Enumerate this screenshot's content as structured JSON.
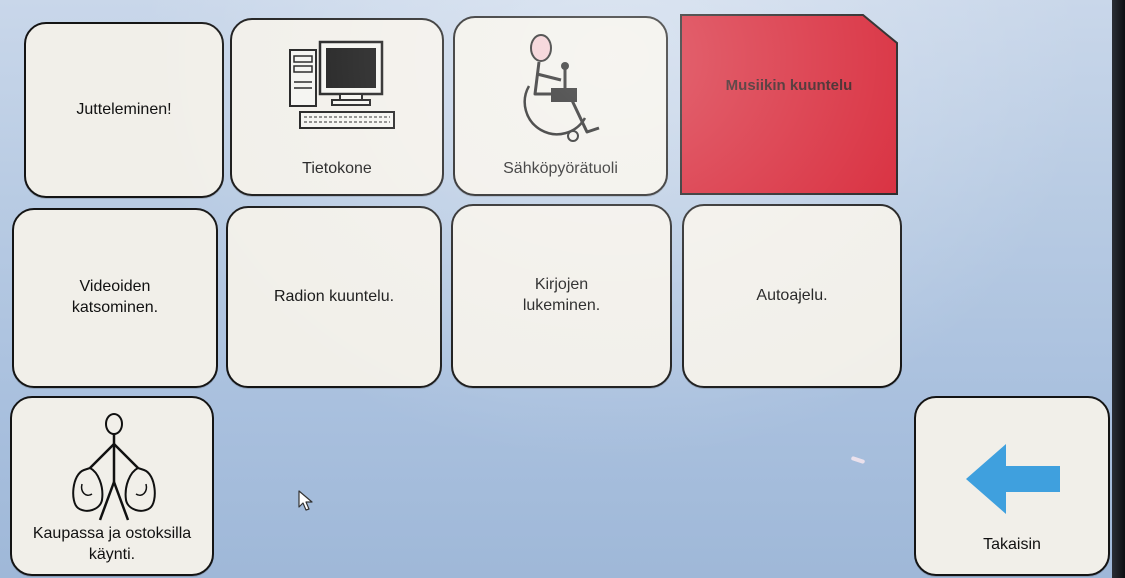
{
  "colors": {
    "tile_bg": "#f1efe9",
    "tile_border": "#141414",
    "highlight_bg": "#d51a2c",
    "arrow": "#3fa0de",
    "screen_bg": "#b8cbe3"
  },
  "tiles": {
    "chatting": {
      "label": "Jutteleminen!"
    },
    "computer": {
      "label": "Tietokone",
      "icon": "computer-icon"
    },
    "wheelchair": {
      "label": "Sähköpyörätuoli",
      "icon": "power-wheelchair-icon"
    },
    "music": {
      "label": "Musiikin kuuntelu",
      "state": "selected"
    },
    "videos": {
      "label": "Videoiden katsominen."
    },
    "radio": {
      "label": "Radion kuuntelu."
    },
    "books": {
      "label": "Kirjojen lukeminen."
    },
    "driving": {
      "label": "Autoajelu."
    },
    "shopping": {
      "label": "Kaupassa ja ostoksilla käynti.",
      "icon": "shopping-bags-person-icon"
    },
    "back": {
      "label": "Takaisin",
      "icon": "arrow-left-icon"
    }
  },
  "pointer": {
    "icon": "mouse-pointer-icon"
  }
}
